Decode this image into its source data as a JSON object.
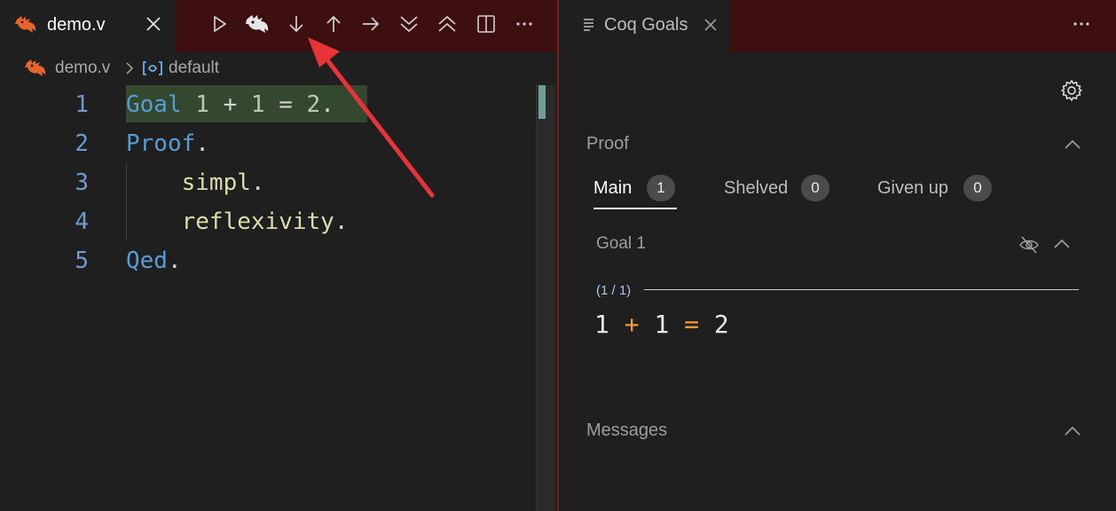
{
  "editor": {
    "tab": {
      "label": "demo.v",
      "icon": "coq-rooster-icon"
    },
    "toolbar": [
      {
        "name": "run-button",
        "icon": "play-icon"
      },
      {
        "name": "coq-button",
        "icon": "rooster-icon"
      },
      {
        "name": "step-forward-button",
        "icon": "arrow-down-icon"
      },
      {
        "name": "step-backward-button",
        "icon": "arrow-up-icon"
      },
      {
        "name": "interpret-to-point-button",
        "icon": "arrow-right-icon"
      },
      {
        "name": "interpret-to-end-button",
        "icon": "chevrons-down-icon"
      },
      {
        "name": "reset-button",
        "icon": "chevrons-up-icon"
      },
      {
        "name": "split-editor-button",
        "icon": "split-icon"
      },
      {
        "name": "more-actions-button",
        "icon": "ellipsis-icon"
      }
    ],
    "breadcrumb": {
      "file": "demo.v",
      "symbol": "default"
    },
    "lines": [
      {
        "number": "1",
        "text": "Goal 1 + 1 = 2."
      },
      {
        "number": "2",
        "text": "Proof."
      },
      {
        "number": "3",
        "text": "    simpl."
      },
      {
        "number": "4",
        "text": "    reflexivity."
      },
      {
        "number": "5",
        "text": "Qed."
      }
    ]
  },
  "goals_panel": {
    "tab": {
      "label": "Coq Goals"
    },
    "proof": {
      "title": "Proof",
      "tabs": [
        {
          "label": "Main",
          "count": "1"
        },
        {
          "label": "Shelved",
          "count": "0"
        },
        {
          "label": "Given up",
          "count": "0"
        }
      ],
      "goal": {
        "title": "Goal 1",
        "counter": "(1 / 1)",
        "tokens": [
          "1",
          " + ",
          "1",
          " = ",
          "2"
        ]
      }
    },
    "messages": {
      "title": "Messages"
    }
  },
  "colors": {
    "tabbar_bg": "#3e0f11",
    "keyword": "#569cd6",
    "tactic": "#dcdcaa",
    "checked_highlight": "#34482f",
    "operator": "#f09c3b",
    "arrow": "#e8333a"
  }
}
